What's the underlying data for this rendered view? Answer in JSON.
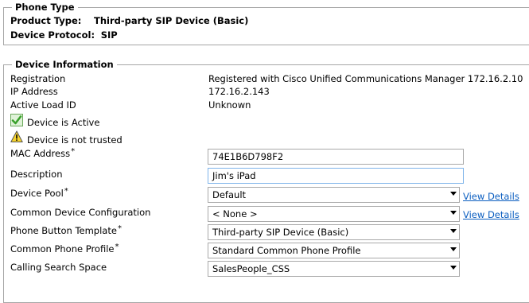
{
  "phone_type": {
    "legend": "Phone Type",
    "product_type_label": "Product Type:",
    "product_type_value": "Third-party SIP Device (Basic)",
    "device_protocol_label": "Device Protocol:",
    "device_protocol_value": "SIP"
  },
  "device_info": {
    "legend": "Device Information",
    "registration_label": "Registration",
    "registration_value": "Registered with Cisco Unified Communications Manager 172.16.2.10",
    "ip_label": "IP Address",
    "ip_value": "172.16.2.143",
    "active_load_label": "Active Load ID",
    "active_load_value": "Unknown",
    "active_status": "Device is Active",
    "trust_status": "Device is not trusted",
    "required_marker": "*",
    "mac_label": "MAC Address",
    "mac_value": "74E1B6D798F2",
    "description_label": "Description",
    "description_value": "Jim's iPad",
    "device_pool_label": "Device Pool",
    "device_pool_value": "Default",
    "common_device_config_label": "Common Device Configuration",
    "common_device_config_value": "< None >",
    "phone_button_template_label": "Phone Button Template",
    "phone_button_template_value": "Third-party SIP Device (Basic)",
    "common_phone_profile_label": "Common Phone Profile",
    "common_phone_profile_value": "Standard Common Phone Profile",
    "calling_search_space_label": "Calling Search Space",
    "calling_search_space_value": "SalesPeople_CSS",
    "view_details_label": "View Details"
  },
  "icons": {
    "active": "check-icon",
    "trust": "warning-icon"
  },
  "colors": {
    "link": "#0b5ec0",
    "check_green": "#3aa12c",
    "warning_yellow": "#f6d32d"
  }
}
